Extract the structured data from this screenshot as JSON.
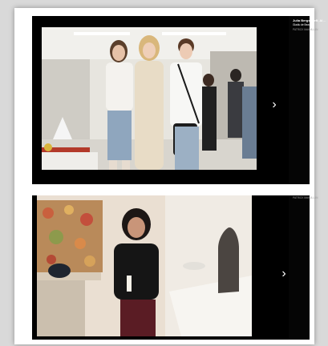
{
  "gallery": {
    "slides": [
      {
        "caption_title": "Julia Bergshoeff, Al…",
        "caption_sub": "Gladiu de Beaux…",
        "caption_meta": "PATRICK McMULLAN",
        "next_icon": "chevron-right-icon",
        "next_glyph": "›"
      },
      {
        "caption_title": "Lisane…",
        "caption_sub": "Ana Rend…",
        "caption_meta": "PATRICK McMULLAN",
        "next_icon": "chevron-right-icon",
        "next_glyph": "›"
      }
    ]
  },
  "colors": {
    "slide_bg": "#000000",
    "page_bg": "#ffffff",
    "outer_bg": "#d9d9d9"
  }
}
